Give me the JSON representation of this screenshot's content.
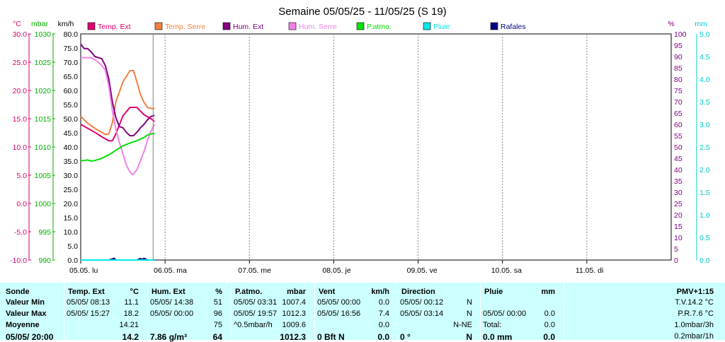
{
  "chart_data": {
    "type": "line",
    "title": "Semaine 05/05/25 - 11/05/25 (S 19)",
    "x_ticks": [
      "05.05.  lu",
      "06.05.  ma",
      "07.05.  me",
      "08.05.  je",
      "09.05.  ve",
      "10.05.  sa",
      "11.05.  di"
    ],
    "x_range_hours": [
      0,
      168
    ],
    "now_hour": 20.5,
    "axes": {
      "temp": {
        "unit": "°C",
        "min": -10,
        "max": 30,
        "color": "#e0006e",
        "ticks": [
          "-10.0",
          "-5.0",
          "0.0",
          "5.0",
          "10.0",
          "15.0",
          "20.0",
          "25.0",
          "30.0"
        ]
      },
      "pressure": {
        "unit": "mbar",
        "min": 990,
        "max": 1030,
        "color": "#00b000",
        "ticks": [
          "990",
          "995",
          "1000",
          "1005",
          "1010",
          "1015",
          "1020",
          "1025",
          "1030"
        ]
      },
      "wind": {
        "unit": "km/h",
        "min": 0,
        "max": 80,
        "color": "#000000",
        "ticks": [
          "0.0",
          "5.0",
          "10.0",
          "15.0",
          "20.0",
          "25.0",
          "30.0",
          "35.0",
          "40.0",
          "45.0",
          "50.0",
          "55.0",
          "60.0",
          "65.0",
          "70.0",
          "75.0",
          "80.0"
        ]
      },
      "hum": {
        "unit": "%",
        "min": 0,
        "max": 100,
        "color": "#800080",
        "ticks": [
          "0",
          "5",
          "10",
          "15",
          "20",
          "25",
          "30",
          "35",
          "40",
          "45",
          "50",
          "55",
          "60",
          "65",
          "70",
          "75",
          "80",
          "85",
          "90",
          "95",
          "100"
        ]
      },
      "rain": {
        "unit": "mm",
        "min": 0,
        "max": 5,
        "color": "#00c8c8",
        "ticks": [
          "0.0",
          "0.5",
          "1.0",
          "1.5",
          "2.0",
          "2.5",
          "3.0",
          "3.5",
          "4.0",
          "4.5",
          "5.0"
        ]
      }
    },
    "legend": [
      {
        "name": "Temp. Ext",
        "color": "#e0006e"
      },
      {
        "name": "Temp. Serre",
        "color": "#f08040"
      },
      {
        "name": "Hum. Ext",
        "color": "#800080"
      },
      {
        "name": "Hum. Serre",
        "color": "#f080e8"
      },
      {
        "name": "P.atmo.",
        "color": "#00e000"
      },
      {
        "name": "Pluie",
        "color": "#00e8e8"
      },
      {
        "name": "Rafales",
        "color": "#000080"
      }
    ],
    "series": [
      {
        "name": "Temp. Ext",
        "axis": "temp",
        "color": "#e0006e",
        "x": [
          0,
          2,
          4,
          6,
          8,
          9,
          10,
          12,
          14,
          16,
          18,
          20,
          21
        ],
        "y": [
          14.0,
          13.3,
          12.6,
          11.8,
          11.1,
          11.1,
          12.3,
          15.5,
          17.0,
          17.0,
          15.7,
          15.0,
          14.5
        ]
      },
      {
        "name": "Temp. Serre",
        "axis": "temp",
        "color": "#f08040",
        "x": [
          0,
          2,
          4,
          6,
          7,
          8,
          9,
          10,
          12,
          14,
          15,
          16,
          17,
          18,
          19,
          20,
          21
        ],
        "y": [
          15.4,
          14.2,
          13.3,
          12.6,
          12.2,
          12.3,
          14.3,
          18.0,
          21.5,
          23.5,
          23.5,
          21.5,
          19.3,
          17.9,
          17.0,
          16.8,
          16.8
        ]
      },
      {
        "name": "Hum. Ext",
        "axis": "hum",
        "color": "#800080",
        "x": [
          0,
          1,
          2,
          3,
          4,
          5,
          6,
          7,
          8,
          9,
          10,
          11,
          12,
          13,
          14,
          15,
          16,
          17,
          18,
          19,
          20,
          21
        ],
        "y": [
          95.5,
          93.5,
          93.5,
          92,
          90,
          89.5,
          89,
          86,
          80,
          70,
          63,
          59,
          58.5,
          56.5,
          55,
          55,
          56.5,
          58.5,
          60,
          62,
          63.5,
          64
        ]
      },
      {
        "name": "Hum. Serre",
        "axis": "hum",
        "color": "#f080e8",
        "x": [
          0,
          1,
          2,
          3,
          4,
          5,
          6,
          7,
          8,
          9,
          10,
          11,
          12,
          13,
          14,
          14.5,
          15,
          16,
          17,
          18,
          19,
          20,
          21
        ],
        "y": [
          89.5,
          89.5,
          89.5,
          89.5,
          88.5,
          87.5,
          86,
          84,
          77,
          66,
          58,
          52,
          47,
          42,
          39,
          38,
          38,
          40,
          44,
          48,
          53,
          57,
          60
        ]
      },
      {
        "name": "P.atmo.",
        "axis": "pressure",
        "color": "#00e000",
        "x": [
          0,
          1,
          2,
          3,
          4,
          5,
          6,
          8,
          10,
          12,
          14,
          16,
          17,
          18,
          19,
          20,
          21
        ],
        "y": [
          1007.6,
          1007.6,
          1007.7,
          1007.5,
          1007.6,
          1007.8,
          1008.0,
          1008.6,
          1009.4,
          1010.2,
          1010.7,
          1011.1,
          1011.4,
          1011.7,
          1012.1,
          1012.3,
          1012.4
        ]
      },
      {
        "name": "Rafales",
        "axis": "wind",
        "color": "#000080",
        "x": [
          0,
          8,
          9,
          9.5,
          10,
          16,
          16.5,
          17,
          17.5,
          18,
          18.5,
          19,
          21
        ],
        "y": [
          0,
          0,
          0.4,
          0.6,
          0,
          0,
          0.3,
          0.5,
          0.2,
          0.6,
          0.3,
          0,
          0
        ]
      },
      {
        "name": "Pluie",
        "axis": "rain",
        "color": "#00e8e8",
        "x": [
          0,
          21
        ],
        "y": [
          0,
          0
        ]
      }
    ]
  },
  "panel": {
    "columns": [
      {
        "h1": "Sonde",
        "h2": "",
        "rows": [
          "Valeur Min",
          "Valeur Max",
          "Moyenne",
          "05/05/ 20:00"
        ],
        "vals": [
          "",
          "",
          "",
          ""
        ]
      },
      {
        "h1": "Temp. Ext",
        "h2": "°C",
        "rows": [
          "05/05/  08:13",
          "05/05/  15:27",
          "",
          ""
        ],
        "vals": [
          "11.1",
          "18.2",
          "14.21",
          "14.2"
        ]
      },
      {
        "h1": "Hum. Ext",
        "h2": "%",
        "rows": [
          "05/05/  14:38",
          "05/05/  00:00",
          "",
          "7.86 g/m³"
        ],
        "vals": [
          "51",
          "96",
          "75",
          "64"
        ]
      },
      {
        "h1": "P.atmo.",
        "h2": "mbar",
        "rows": [
          "05/05/  03:31",
          "05/05/  19:57",
          "^0.5mbar/h",
          ""
        ],
        "vals": [
          "1007.4",
          "1012.3",
          "1009.6",
          "1012.3"
        ]
      },
      {
        "h1": "Vent",
        "h2": "km/h",
        "rows": [
          "05/05/  00:00",
          "05/05/  16:56",
          "",
          "0 Bft N"
        ],
        "vals": [
          "0.0",
          "7.4",
          "0.0",
          "0.0"
        ]
      },
      {
        "h1": "Direction",
        "h2": "",
        "rows": [
          "05/05/  00:12",
          "05/05/  03:14",
          "",
          "0 °"
        ],
        "vals": [
          "N",
          "N",
          "N-NE",
          "N"
        ]
      },
      {
        "h1": "Pluie",
        "h2": "mm",
        "rows": [
          "",
          "05/05/  00:00",
          "Total:",
          "0.0 mm"
        ],
        "vals": [
          "",
          "0.0",
          "0.0",
          "0.0"
        ]
      }
    ],
    "pmv": {
      "title": "PMV+1:15",
      "lines": [
        "T.V.14.2 °C",
        "P.R.7.6 °C",
        "1.0mbar/3h",
        "0.2mbar/1h"
      ]
    }
  }
}
